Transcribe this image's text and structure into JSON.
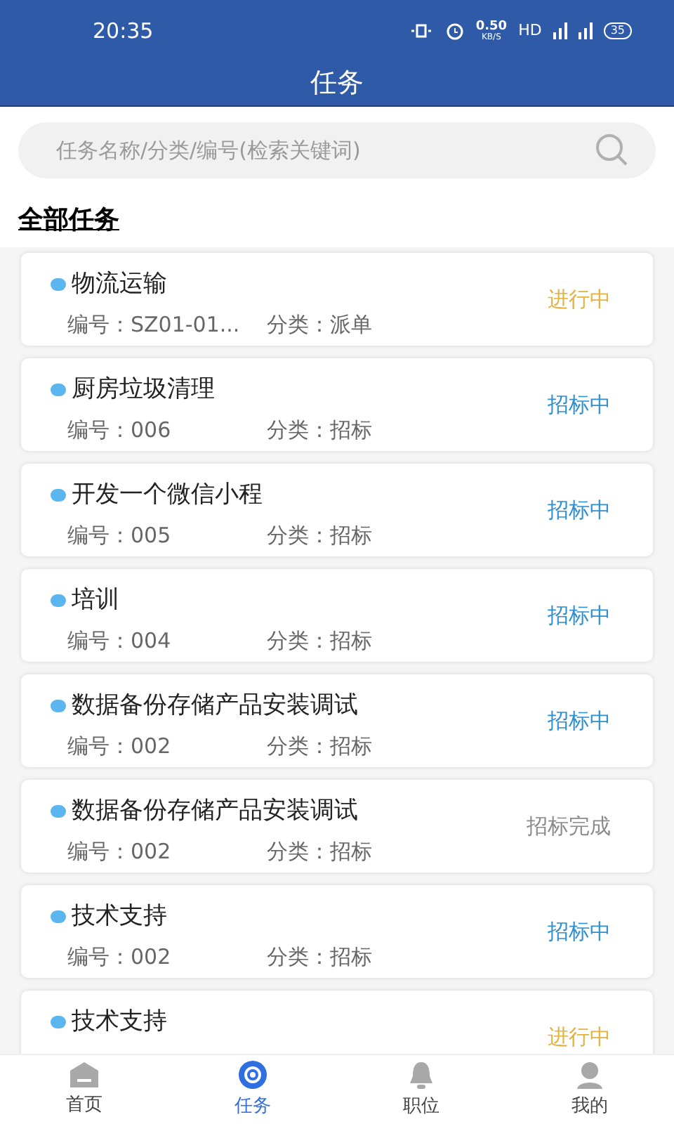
{
  "status_bar": {
    "time": "20:35",
    "speed": "0.50",
    "speed_unit": "KB/S",
    "hd": "HD",
    "battery": "35"
  },
  "header": {
    "title": "任务"
  },
  "search": {
    "placeholder": "任务名称/分类/编号(检索关键词)"
  },
  "section_title": "全部任务",
  "tasks": [
    {
      "name": "物流运输",
      "number": "编号：SZ01-01...",
      "category": "分类：派单",
      "status": "进行中",
      "kind": "ongoing"
    },
    {
      "name": "厨房垃圾清理",
      "number": "编号：006",
      "category": "分类：招标",
      "status": "招标中",
      "kind": "bidding"
    },
    {
      "name": "开发一个微信小程",
      "number": "编号：005",
      "category": "分类：招标",
      "status": "招标中",
      "kind": "bidding"
    },
    {
      "name": "培训",
      "number": "编号：004",
      "category": "分类：招标",
      "status": "招标中",
      "kind": "bidding"
    },
    {
      "name": "数据备份存储产品安装调试",
      "number": "编号：002",
      "category": "分类：招标",
      "status": "招标中",
      "kind": "bidding"
    },
    {
      "name": "数据备份存储产品安装调试",
      "number": "编号：002",
      "category": "分类：招标",
      "status": "招标完成",
      "kind": "done"
    },
    {
      "name": "技术支持",
      "number": "编号：002",
      "category": "分类：招标",
      "status": "招标中",
      "kind": "bidding"
    },
    {
      "name": "技术支持",
      "status": "进行中",
      "kind": "ongoing"
    }
  ],
  "tabs": [
    {
      "label": "首页",
      "selected": false
    },
    {
      "label": "任务",
      "selected": true
    },
    {
      "label": "职位",
      "selected": false
    },
    {
      "label": "我的",
      "selected": false
    }
  ]
}
